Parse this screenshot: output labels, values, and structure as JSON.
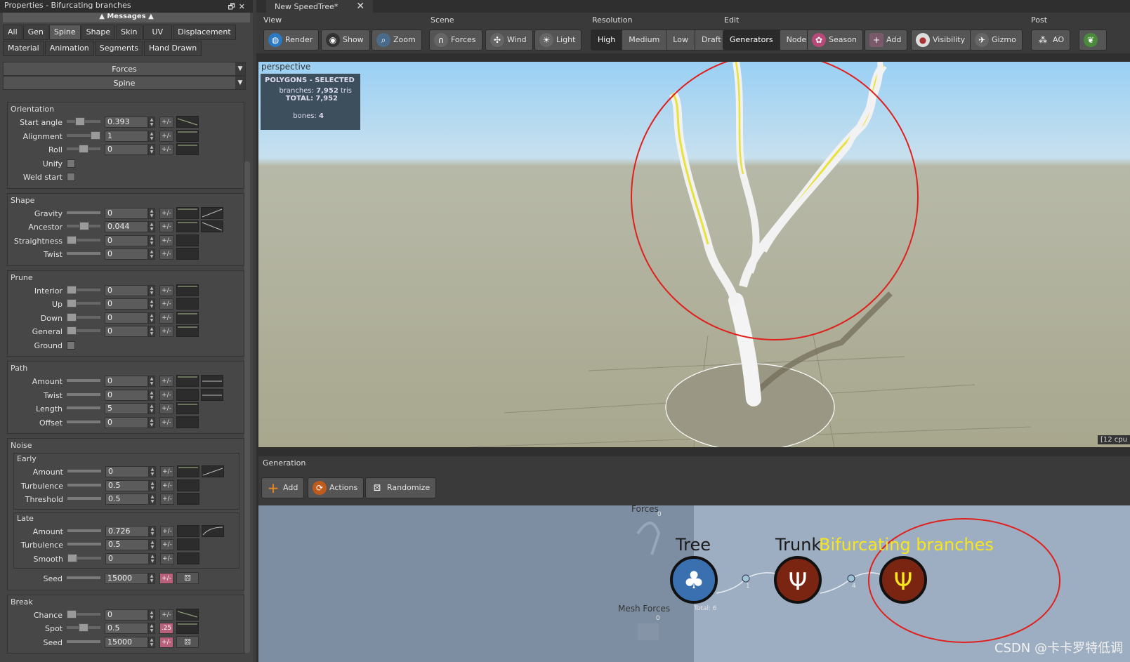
{
  "left_panel": {
    "title": "Properties - Bifurcating branches",
    "messages_label": "Messages",
    "tabs_row1": [
      "All",
      "Gen",
      "Spine",
      "Shape",
      "Skin",
      "UV",
      "Displacement",
      "Material"
    ],
    "tabs_row2": [
      "Animation",
      "Segments",
      "Hand Drawn"
    ],
    "active_tab": "Spine",
    "combo1": "Forces",
    "combo2": "Spine",
    "groups": {
      "orientation": {
        "title": "Orientation",
        "rows": [
          {
            "label": "Start angle",
            "value": "0.393"
          },
          {
            "label": "Alignment",
            "value": "1"
          },
          {
            "label": "Roll",
            "value": "0"
          }
        ],
        "checks": [
          "Unify",
          "Weld start"
        ]
      },
      "shape": {
        "title": "Shape",
        "rows": [
          {
            "label": "Gravity",
            "value": "0"
          },
          {
            "label": "Ancestor",
            "value": "0.044"
          },
          {
            "label": "Straightness",
            "value": "0"
          },
          {
            "label": "Twist",
            "value": "0"
          }
        ]
      },
      "prune": {
        "title": "Prune",
        "rows": [
          {
            "label": "Interior",
            "value": "0"
          },
          {
            "label": "Up",
            "value": "0"
          },
          {
            "label": "Down",
            "value": "0"
          },
          {
            "label": "General",
            "value": "0"
          }
        ],
        "checks": [
          "Ground"
        ]
      },
      "path": {
        "title": "Path",
        "rows": [
          {
            "label": "Amount",
            "value": "0"
          },
          {
            "label": "Twist",
            "value": "0"
          },
          {
            "label": "Length",
            "value": "5"
          },
          {
            "label": "Offset",
            "value": "0"
          }
        ]
      },
      "noise": {
        "title": "Noise",
        "early": {
          "title": "Early",
          "rows": [
            {
              "label": "Amount",
              "value": "0"
            },
            {
              "label": "Turbulence",
              "value": "0.5"
            },
            {
              "label": "Threshold",
              "value": "0.5"
            }
          ]
        },
        "late": {
          "title": "Late",
          "rows": [
            {
              "label": "Amount",
              "value": "0.726"
            },
            {
              "label": "Turbulence",
              "value": "0.5"
            },
            {
              "label": "Smooth",
              "value": "0"
            }
          ]
        },
        "seed": {
          "label": "Seed",
          "value": "15000"
        }
      },
      "break": {
        "title": "Break",
        "rows": [
          {
            "label": "Chance",
            "value": "0"
          },
          {
            "label": "Spot",
            "value": "0.5"
          },
          {
            "label": "Seed",
            "value": "15000"
          }
        ]
      }
    },
    "pm_label": "+/-",
    "spot_pm_label": ".25"
  },
  "document_tab": "New SpeedTree*",
  "toolbar": {
    "view": {
      "title": "View",
      "buttons": [
        "Render",
        "Show",
        "Zoom"
      ]
    },
    "scene": {
      "title": "Scene",
      "buttons": [
        "Forces",
        "Wind",
        "Light"
      ]
    },
    "resolution": {
      "title": "Resolution",
      "options": [
        "High",
        "Medium",
        "Low",
        "Draft"
      ],
      "selected": "High"
    },
    "edit": {
      "title": "Edit",
      "options": [
        "Generators",
        "Nodes"
      ],
      "selected": "Generators",
      "buttons": [
        "Season",
        "Add",
        "Visibility",
        "Gizmo"
      ]
    },
    "post": {
      "title": "Post",
      "buttons": [
        "AO"
      ]
    }
  },
  "viewport": {
    "label": "perspective",
    "stats_title": "POLYGONS - SELECTED",
    "branches_label": "branches:",
    "branches_value": "7,952",
    "branches_unit": "tris",
    "total_label": "TOTAL:",
    "total_value": "7,952",
    "bones_label": "bones:",
    "bones_value": "4",
    "cpu_label": "[12 cpu"
  },
  "generation": {
    "header": "Generation",
    "buttons": [
      "Add",
      "Actions",
      "Randomize"
    ],
    "nodes": {
      "tree": "Tree",
      "trunk": "Trunk",
      "bifurcating": "Bifurcating branches",
      "forces": "Forces",
      "forces_count": "0",
      "mesh_forces": "Mesh Forces",
      "mesh_forces_count": "0",
      "total": "Total: 6",
      "link1": "1",
      "link2": "4"
    }
  },
  "watermark": "CSDN @卡卡罗特低调",
  "colors": {
    "selected_node": "#f7e51d",
    "annotation_circle": "#e0201c",
    "tree_node": "#3a6fb0",
    "trunk_node": "#7a2412"
  }
}
